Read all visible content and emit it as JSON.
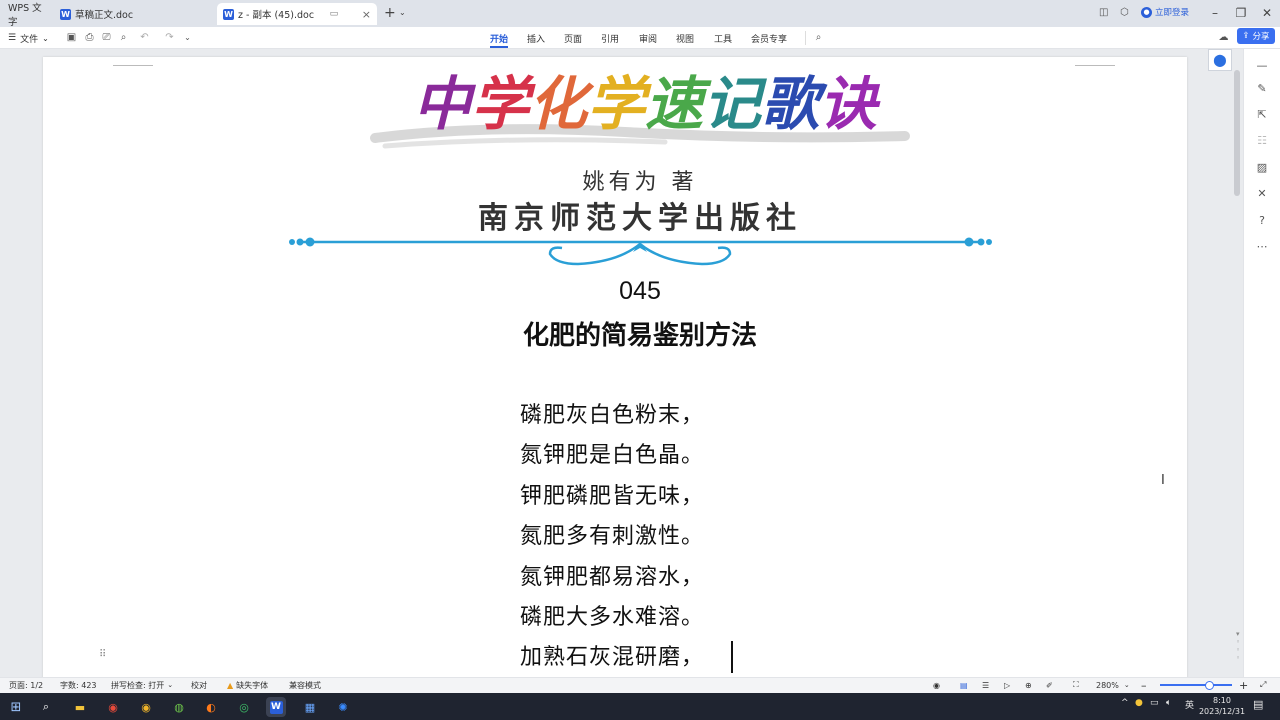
{
  "titlebar": {
    "tabs": [
      {
        "label": "WPS 文字"
      },
      {
        "label": "草稿正文.doc"
      },
      {
        "label": "z - 副本 (45).doc"
      }
    ],
    "login": "立即登录",
    "new_tab": "+"
  },
  "toolbar": {
    "file_menu": "文件",
    "ribbon_tabs": [
      "开始",
      "插入",
      "页面",
      "引用",
      "审阅",
      "视图",
      "工具",
      "会员专享"
    ],
    "active_tab": "开始",
    "share": "分享"
  },
  "document": {
    "book_title": "中学化学速记歌诀",
    "book_title_colors": [
      "#8a2a9a",
      "#d6324a",
      "#e0683a",
      "#e3b021",
      "#4aa84a",
      "#2a8a8a",
      "#2b4bb0",
      "#9a2ab0"
    ],
    "author": "姚有为 著",
    "publisher": "南京师范大学出版社",
    "section_number": "045",
    "heading": "化肥的简易鉴别方法",
    "poem": [
      "磷肥灰白色粉末，",
      "氮钾肥是白色晶。",
      "钾肥磷肥皆无味，",
      "氮肥多有刺激性。",
      "氮钾肥都易溶水，",
      "磷肥大多水难溶。",
      "加熟石灰混研磨，"
    ]
  },
  "statusbar": {
    "page": "页面: 1/2",
    "words": "字数: 423",
    "spellcheck": "拼写检查: 打开",
    "proofread": "校对",
    "missing_font": "缺失字体",
    "compat": "兼容模式",
    "zoom": "280%",
    "zoom_level": 0.62
  },
  "taskbar": {
    "ime": "英",
    "time": "8:10",
    "date": "2023/12/31"
  },
  "colors": {
    "accent": "#2b5fd9",
    "divider": "#2a9fd6"
  }
}
